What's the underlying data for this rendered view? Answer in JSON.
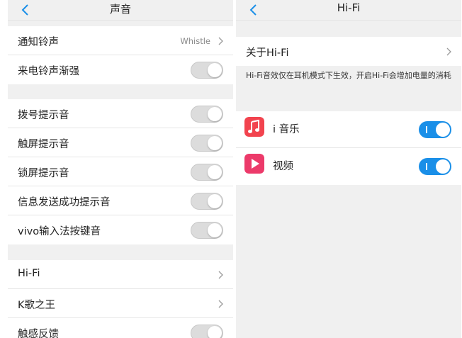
{
  "sound_screen": {
    "title": "声音",
    "group1": [
      {
        "label": "通知铃声",
        "value": "Whistle"
      },
      {
        "label": "来电铃声渐强"
      }
    ],
    "group2": [
      {
        "label": "拨号提示音"
      },
      {
        "label": "触屏提示音"
      },
      {
        "label": "锁屏提示音"
      },
      {
        "label": "信息发送成功提示音"
      },
      {
        "label": "vivo输入法按键音"
      }
    ],
    "group3": [
      {
        "label": "Hi-Fi"
      },
      {
        "label": "K歌之王"
      },
      {
        "label": "触感反馈"
      }
    ]
  },
  "hifi_screen": {
    "title": "Hi-Fi",
    "about_label": "关于Hi-Fi",
    "note": "Hi-Fi音效仅在耳机模式下生效，开启Hi-Fi会增加电量的消耗",
    "apps": [
      {
        "label": "i 音乐",
        "icon": "music-note-icon",
        "icon_color": "#f2434e",
        "enabled": true
      },
      {
        "label": "视频",
        "icon": "play-icon",
        "icon_color": "#ec3a6a",
        "enabled": true
      }
    ]
  },
  "colors": {
    "accent": "#1a8fe8",
    "background": "#f0f0f0"
  }
}
